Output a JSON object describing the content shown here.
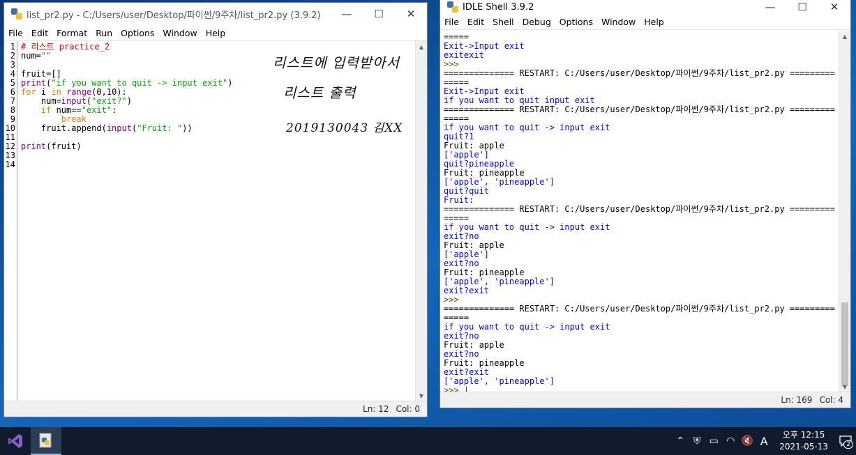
{
  "editor": {
    "title": "list_pr2.py - C:/Users/user/Desktop/파이썬/9주차/list_pr2.py (3.9.2)",
    "menu": [
      "File",
      "Edit",
      "Format",
      "Run",
      "Options",
      "Window",
      "Help"
    ],
    "line_numbers": [
      "1",
      "2",
      "3",
      "4",
      "5",
      "6",
      "7",
      "8",
      "9",
      "10",
      "11",
      "12",
      "13",
      "14"
    ],
    "lines": [
      [
        {
          "t": "# 리스트 practice_2",
          "c": "comment"
        }
      ],
      [
        {
          "t": "num=",
          "c": "def"
        },
        {
          "t": "\"\"",
          "c": "str"
        }
      ],
      [],
      [
        {
          "t": "fruit=[]",
          "c": "def"
        }
      ],
      [
        {
          "t": "print",
          "c": "bi"
        },
        {
          "t": "(",
          "c": "def"
        },
        {
          "t": "\"if you want to quit -> input exit\"",
          "c": "str"
        },
        {
          "t": ")",
          "c": "def"
        }
      ],
      [
        {
          "t": "for",
          "c": "kw"
        },
        {
          "t": " i ",
          "c": "def"
        },
        {
          "t": "in",
          "c": "kw"
        },
        {
          "t": " ",
          "c": "def"
        },
        {
          "t": "range",
          "c": "bi"
        },
        {
          "t": "(0,10):",
          "c": "def"
        }
      ],
      [
        {
          "t": "    num=",
          "c": "def"
        },
        {
          "t": "input",
          "c": "bi"
        },
        {
          "t": "(",
          "c": "def"
        },
        {
          "t": "\"exit?\"",
          "c": "str"
        },
        {
          "t": ")",
          "c": "def"
        }
      ],
      [
        {
          "t": "    ",
          "c": "def"
        },
        {
          "t": "if",
          "c": "kw"
        },
        {
          "t": " num==",
          "c": "def"
        },
        {
          "t": "\"exit\"",
          "c": "str"
        },
        {
          "t": ":",
          "c": "def"
        }
      ],
      [
        {
          "t": "        ",
          "c": "def"
        },
        {
          "t": "break",
          "c": "kw"
        }
      ],
      [
        {
          "t": "    fruit.append(",
          "c": "def"
        },
        {
          "t": "input",
          "c": "bi"
        },
        {
          "t": "(",
          "c": "def"
        },
        {
          "t": "\"Fruit: \"",
          "c": "str"
        },
        {
          "t": "))",
          "c": "def"
        }
      ],
      [],
      [
        {
          "t": "print",
          "c": "bi"
        },
        {
          "t": "(fruit)",
          "c": "def"
        }
      ],
      [],
      []
    ],
    "handwriting": [
      "리스트에 입력받아서",
      "리스트 출력",
      "2019130043 김XX"
    ],
    "status": {
      "ln": "Ln: 12",
      "col": "Col: 0"
    }
  },
  "shell": {
    "title": "IDLE Shell 3.9.2",
    "menu": [
      "File",
      "Edit",
      "Shell",
      "Debug",
      "Options",
      "Window",
      "Help"
    ],
    "lines": [
      {
        "t": "=====",
        "c": "restart"
      },
      {
        "t": "Exit->Input exit",
        "c": "stdout"
      },
      {
        "t": "exitexit",
        "c": "stdout"
      },
      {
        "t": ">>>",
        "c": "prompt"
      },
      {
        "t": "============== RESTART: C:/Users/user/Desktop/파이썬/9주차/list_pr2.py =========",
        "c": "restart"
      },
      {
        "t": "=====",
        "c": "restart"
      },
      {
        "t": "Exit->Input exit",
        "c": "stdout"
      },
      {
        "t": "if you want to quit input exit",
        "c": "stdout"
      },
      {
        "t": "============== RESTART: C:/Users/user/Desktop/파이썬/9주차/list_pr2.py =========",
        "c": "restart"
      },
      {
        "t": "=====",
        "c": "restart"
      },
      {
        "t": "if you want to quit -> input exit",
        "c": "stdout"
      },
      {
        "t": "quit?1",
        "c": "stdout"
      },
      {
        "t": "Fruit: apple",
        "c": "stdin"
      },
      {
        "t": "['apple']",
        "c": "stdout"
      },
      {
        "t": "quit?pineapple",
        "c": "stdout"
      },
      {
        "t": "Fruit: pineapple",
        "c": "stdin"
      },
      {
        "t": "['apple', 'pineapple']",
        "c": "stdout"
      },
      {
        "t": "quit?quit",
        "c": "stdout"
      },
      {
        "t": "Fruit:",
        "c": "stdout"
      },
      {
        "t": "============== RESTART: C:/Users/user/Desktop/파이썬/9주차/list_pr2.py =========",
        "c": "restart"
      },
      {
        "t": "=====",
        "c": "restart"
      },
      {
        "t": "if you want to quit -> input exit",
        "c": "stdout"
      },
      {
        "t": "exit?no",
        "c": "stdout"
      },
      {
        "t": "Fruit: apple",
        "c": "stdin"
      },
      {
        "t": "['apple']",
        "c": "stdout"
      },
      {
        "t": "exit?no",
        "c": "stdout"
      },
      {
        "t": "Fruit: pineapple",
        "c": "stdin"
      },
      {
        "t": "['apple', 'pineapple']",
        "c": "stdout"
      },
      {
        "t": "exit?exit",
        "c": "stdout"
      },
      {
        "t": ">>>",
        "c": "prompt"
      },
      {
        "t": "============== RESTART: C:/Users/user/Desktop/파이썬/9주차/list_pr2.py =========",
        "c": "restart"
      },
      {
        "t": "=====",
        "c": "restart"
      },
      {
        "t": "if you want to quit -> input exit",
        "c": "stdout"
      },
      {
        "t": "exit?no",
        "c": "stdout"
      },
      {
        "t": "Fruit: apple",
        "c": "stdin"
      },
      {
        "t": "exit?no",
        "c": "stdout"
      },
      {
        "t": "Fruit: pineapple",
        "c": "stdin"
      },
      {
        "t": "exit?exit",
        "c": "stdout"
      },
      {
        "t": "['apple', 'pineapple']",
        "c": "stdout"
      },
      {
        "t": ">>> |",
        "c": "prompt"
      }
    ],
    "status": {
      "ln": "Ln: 169",
      "col": "Col: 4"
    }
  },
  "taskbar": {
    "apps": [
      "visual-studio-icon",
      "python-idle-icon"
    ],
    "tray_input_indicator": "A",
    "clock_time": "오후 12:15",
    "clock_date": "2021-05-13",
    "notification_count": "2"
  },
  "colors": {
    "comment": "#dd0000",
    "keyword": "#ff7700",
    "builtin": "#900090",
    "string": "#00aa00",
    "stdout": "#0000ff",
    "prompt": "#7a3b00"
  }
}
